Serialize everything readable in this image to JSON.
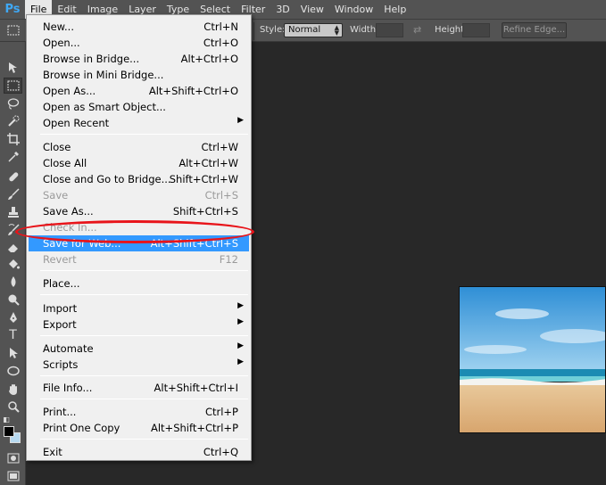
{
  "app": {
    "logo": "Ps"
  },
  "menubar": {
    "items": [
      "File",
      "Edit",
      "Image",
      "Layer",
      "Type",
      "Select",
      "Filter",
      "3D",
      "View",
      "Window",
      "Help"
    ]
  },
  "options": {
    "style_label": "Style:",
    "style_value": "Normal",
    "width_label": "Width:",
    "height_label": "Height:",
    "refine_edge": "Refine Edge..."
  },
  "file_menu": {
    "new": {
      "label": "New...",
      "shortcut": "Ctrl+N"
    },
    "open": {
      "label": "Open...",
      "shortcut": "Ctrl+O"
    },
    "browse_bridge": {
      "label": "Browse in Bridge...",
      "shortcut": "Alt+Ctrl+O"
    },
    "browse_mini": {
      "label": "Browse in Mini Bridge..."
    },
    "open_as": {
      "label": "Open As...",
      "shortcut": "Alt+Shift+Ctrl+O"
    },
    "open_smart": {
      "label": "Open as Smart Object..."
    },
    "open_recent": {
      "label": "Open Recent"
    },
    "close": {
      "label": "Close",
      "shortcut": "Ctrl+W"
    },
    "close_all": {
      "label": "Close All",
      "shortcut": "Alt+Ctrl+W"
    },
    "close_go_bridge": {
      "label": "Close and Go to Bridge...",
      "shortcut": "Shift+Ctrl+W"
    },
    "save": {
      "label": "Save",
      "shortcut": "Ctrl+S"
    },
    "save_as": {
      "label": "Save As...",
      "shortcut": "Shift+Ctrl+S"
    },
    "check_in": {
      "label": "Check In..."
    },
    "save_for_web": {
      "label": "Save for Web...",
      "shortcut": "Alt+Shift+Ctrl+S"
    },
    "revert": {
      "label": "Revert",
      "shortcut": "F12"
    },
    "place": {
      "label": "Place..."
    },
    "import": {
      "label": "Import"
    },
    "export": {
      "label": "Export"
    },
    "automate": {
      "label": "Automate"
    },
    "scripts": {
      "label": "Scripts"
    },
    "file_info": {
      "label": "File Info...",
      "shortcut": "Alt+Shift+Ctrl+I"
    },
    "print": {
      "label": "Print...",
      "shortcut": "Ctrl+P"
    },
    "print_one": {
      "label": "Print One Copy",
      "shortcut": "Alt+Shift+Ctrl+P"
    },
    "exit": {
      "label": "Exit",
      "shortcut": "Ctrl+Q"
    }
  },
  "colors": {
    "highlight": "#3399ff",
    "annotation_ring": "#e8141a",
    "foreground_swatch": "#000000",
    "background_swatch": "#b7d9f0"
  },
  "toolbar_icons": [
    "move-tool-icon",
    "rectangular-marquee-icon",
    "lasso-icon",
    "quick-selection-icon",
    "crop-icon",
    "eyedropper-icon",
    "spot-healing-icon",
    "brush-icon",
    "clone-stamp-icon",
    "history-brush-icon",
    "eraser-icon",
    "paint-bucket-icon",
    "blur-icon",
    "dodge-icon",
    "pen-icon",
    "type-icon",
    "path-selection-icon",
    "ellipse-icon",
    "hand-icon",
    "zoom-icon"
  ]
}
